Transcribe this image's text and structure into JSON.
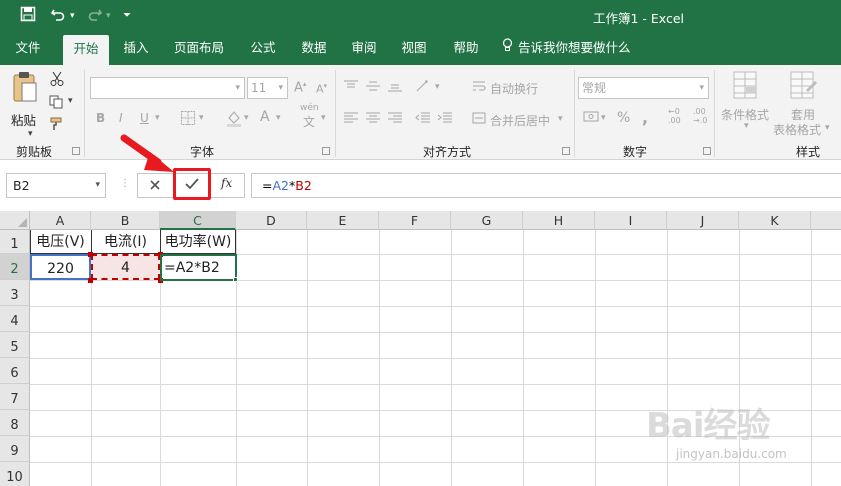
{
  "window": {
    "title": "工作簿1  -  Excel"
  },
  "tabs": [
    {
      "label": "文件"
    },
    {
      "label": "开始"
    },
    {
      "label": "插入"
    },
    {
      "label": "页面布局"
    },
    {
      "label": "公式"
    },
    {
      "label": "数据"
    },
    {
      "label": "审阅"
    },
    {
      "label": "视图"
    },
    {
      "label": "帮助"
    },
    {
      "label": "告诉我你想要做什么"
    }
  ],
  "ribbon": {
    "clipboard": {
      "paste_label": "粘贴",
      "group_label": "剪贴板"
    },
    "font": {
      "font_size": "11",
      "group_label": "字体",
      "bold": "B",
      "italic": "I",
      "underline": "U",
      "phonetic": "wén"
    },
    "alignment": {
      "wrap_text": "自动换行",
      "merge_center": "合并后居中",
      "group_label": "对齐方式"
    },
    "number": {
      "format": "常规",
      "group_label": "数字"
    },
    "styles": {
      "conditional_format": "条件格式",
      "table_format_line1": "套用",
      "table_format_line2": "表格格式",
      "group_label": "样式"
    }
  },
  "formula_bar": {
    "name_box": "B2",
    "fx": "fx",
    "formula_eq": "=",
    "formula_ref1": "A2",
    "formula_op": "*",
    "formula_ref2": "B2"
  },
  "grid": {
    "columns": [
      "A",
      "B",
      "C",
      "D",
      "E",
      "F",
      "G",
      "H",
      "I",
      "J",
      "K"
    ],
    "rows": [
      "1",
      "2",
      "3",
      "4",
      "5",
      "6",
      "7",
      "8",
      "9",
      "10"
    ],
    "cells": {
      "A1": "电压(V)",
      "B1": "电流(I)",
      "C1": "电功率(W)",
      "A2": "220",
      "B2": "4",
      "C2": "=A2*B2"
    }
  },
  "watermark": {
    "line1": "Bai经验",
    "line2": "jingyan.baidu.com"
  },
  "colors": {
    "accent": "#217346",
    "ref_a": "#4472c4",
    "ref_b": "#c00000",
    "highlight": "#e8191f"
  }
}
